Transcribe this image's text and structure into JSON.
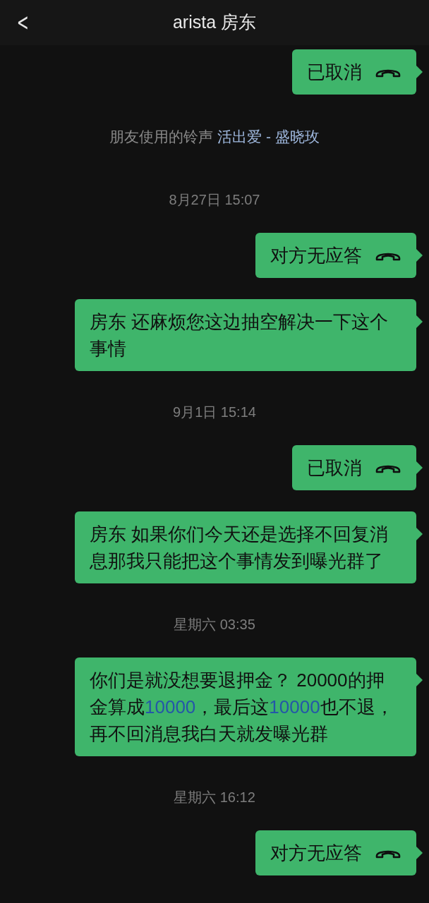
{
  "header": {
    "back": "<",
    "title": "arista 房东"
  },
  "messages": [
    {
      "kind": "call",
      "text": "已取消"
    },
    {
      "kind": "system",
      "segments": [
        {
          "text": "朋友使用的铃声 ",
          "link": false
        },
        {
          "text": "活出爱 - 盛晓玫",
          "link": true
        }
      ]
    },
    {
      "kind": "time",
      "text": "8月27日 15:07"
    },
    {
      "kind": "call",
      "text": "对方无应答"
    },
    {
      "kind": "text",
      "segments": [
        {
          "text": "房东 还麻烦您这边抽空解决一下这个事情",
          "link": false
        }
      ]
    },
    {
      "kind": "time",
      "text": "9月1日 15:14"
    },
    {
      "kind": "call",
      "text": "已取消"
    },
    {
      "kind": "text",
      "segments": [
        {
          "text": "房东 如果你们今天还是选择不回复消息那我只能把这个事情发到曝光群了",
          "link": false
        }
      ]
    },
    {
      "kind": "time",
      "text": "星期六 03:35"
    },
    {
      "kind": "text",
      "segments": [
        {
          "text": "你们是就没想要退押金？ 20000的押金算成",
          "link": false
        },
        {
          "text": "10000",
          "link": true
        },
        {
          "text": "，最后这",
          "link": false
        },
        {
          "text": "10000",
          "link": true
        },
        {
          "text": "也不退，再不回消息我白天就发曝光群",
          "link": false
        }
      ]
    },
    {
      "kind": "time",
      "text": "星期六 16:12"
    },
    {
      "kind": "call",
      "text": "对方无应答"
    }
  ]
}
